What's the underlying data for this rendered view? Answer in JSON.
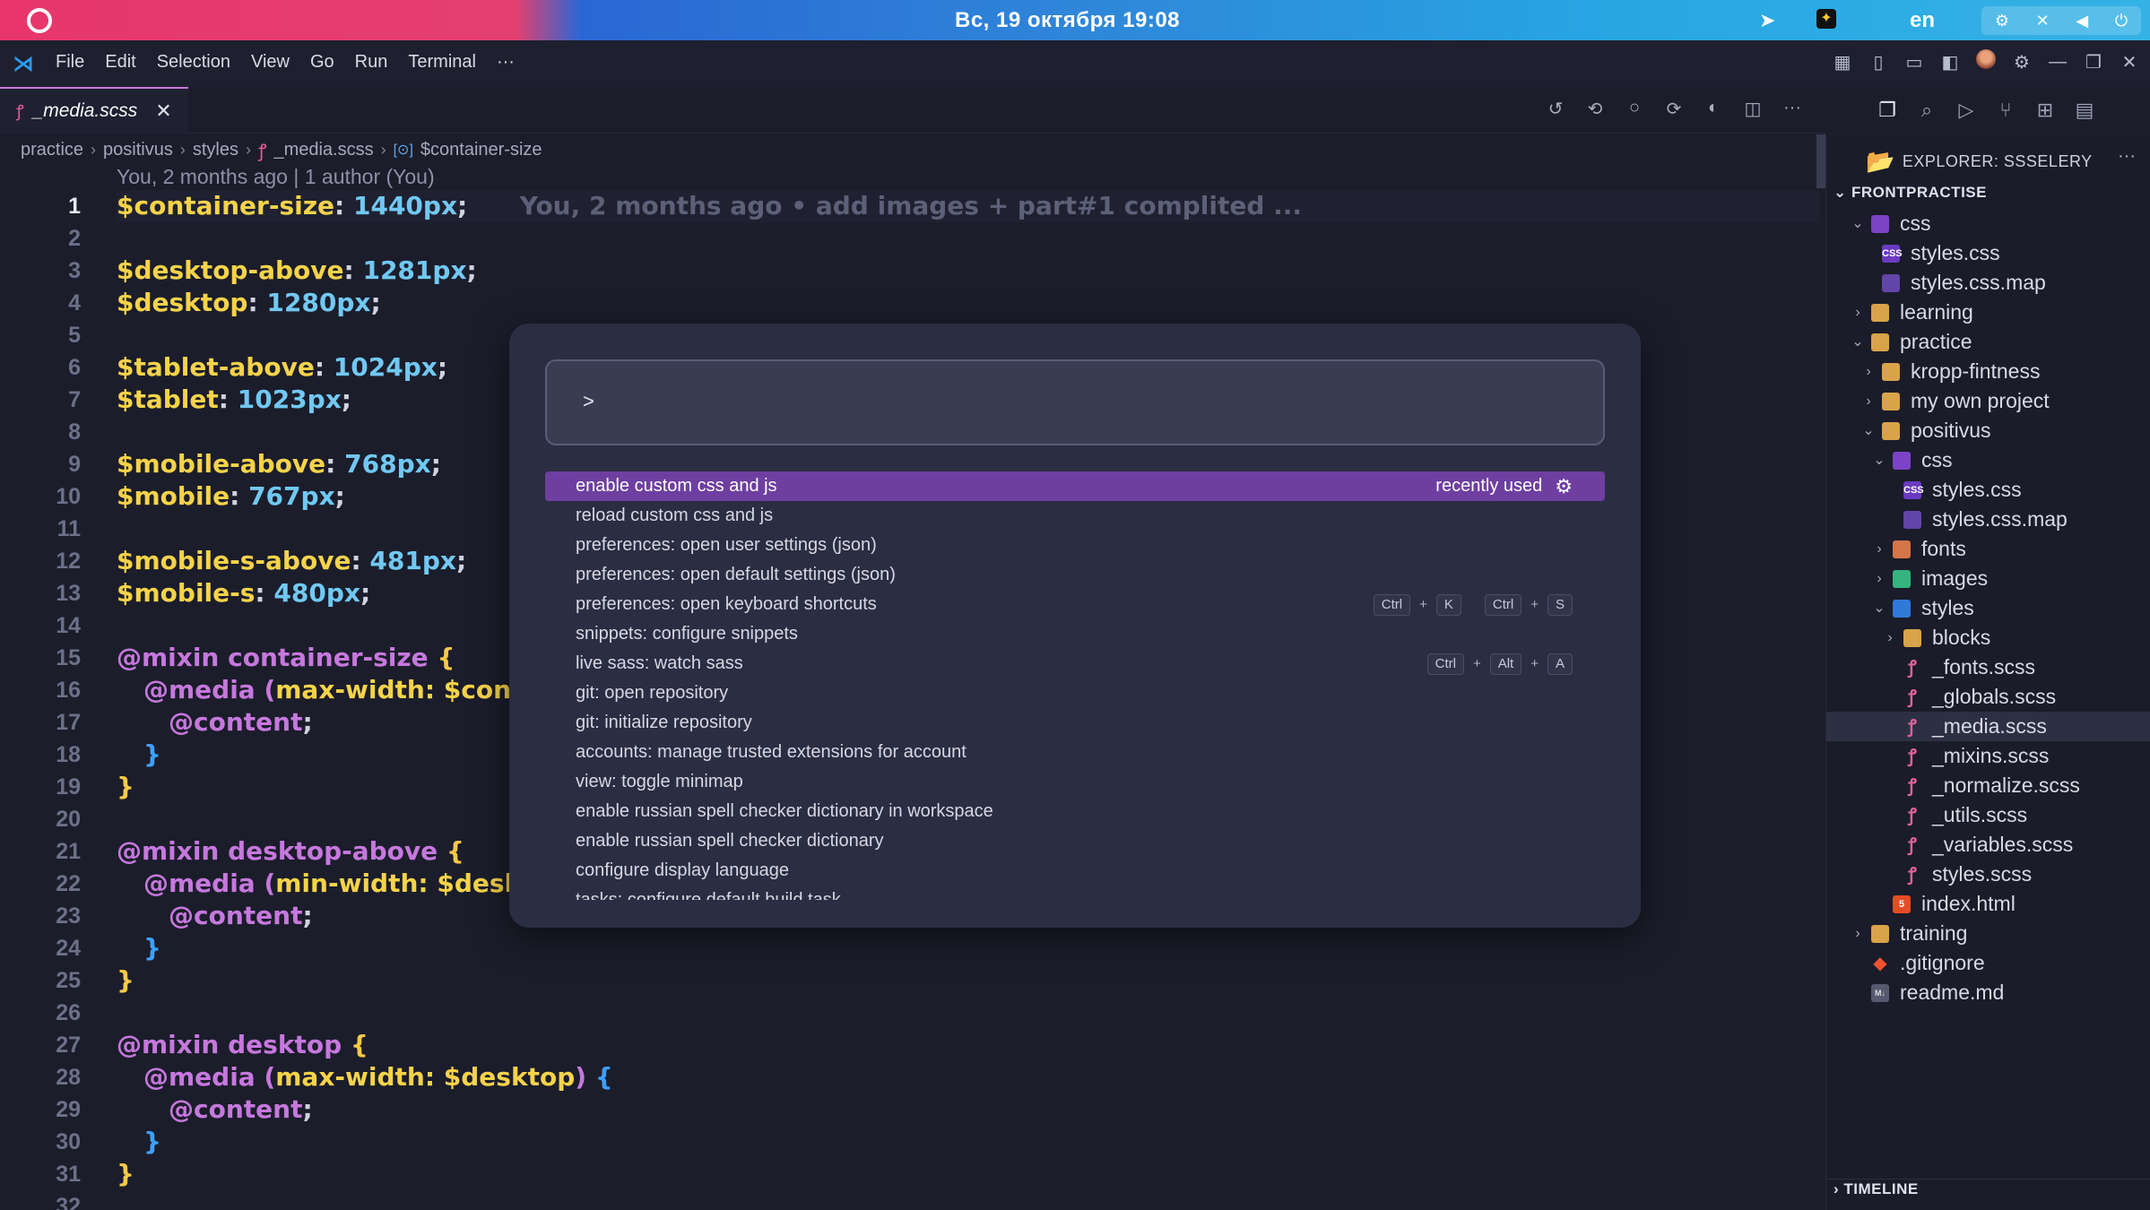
{
  "system_bar": {
    "clock": "Вс, 19 октября  19:08",
    "lang": "en"
  },
  "menubar": {
    "items": [
      "File",
      "Edit",
      "Selection",
      "View",
      "Go",
      "Run",
      "Terminal",
      "···"
    ]
  },
  "tab": {
    "name": "_media.scss",
    "close": "✕"
  },
  "breadcrumb": [
    "practice",
    "positivus",
    "styles",
    "_media.scss",
    "$container-size"
  ],
  "codelens": "You, 2 months ago | 1 author (You)",
  "blame": "You, 2 months ago • add images + part#1 complited ...",
  "line_numbers": [
    "1",
    "2",
    "3",
    "4",
    "5",
    "6",
    "7",
    "8",
    "9",
    "10",
    "11",
    "12",
    "13",
    "14",
    "15",
    "16",
    "17",
    "18",
    "19",
    "20",
    "21",
    "22",
    "23",
    "24",
    "25",
    "26",
    "27",
    "28",
    "29",
    "30",
    "31",
    "32"
  ],
  "code": {
    "l1": {
      "var": "$container-size",
      "colon": ":",
      "val": "1440px",
      "semi": ";"
    },
    "l3": {
      "var": "$desktop-above",
      "colon": ":",
      "val": "1281px",
      "semi": ";"
    },
    "l4": {
      "var": "$desktop",
      "colon": ":",
      "val": "1280px",
      "semi": ";"
    },
    "l6": {
      "var": "$tablet-above",
      "colon": ":",
      "val": "1024px",
      "semi": ";"
    },
    "l7": {
      "var": "$tablet",
      "colon": ":",
      "val": "1023px",
      "semi": ";"
    },
    "l9": {
      "var": "$mobile-above",
      "colon": ":",
      "val": "768px",
      "semi": ";"
    },
    "l10": {
      "var": "$mobile",
      "colon": ":",
      "val": "767px",
      "semi": ";"
    },
    "l12": {
      "var": "$mobile-s-above",
      "colon": ":",
      "val": "481px",
      "semi": ";"
    },
    "l13": {
      "var": "$mobile-s",
      "colon": ":",
      "val": "480px",
      "semi": ";"
    },
    "l15": {
      "kw": "@mixin",
      "name": "container-size",
      "brace": "{"
    },
    "l16": {
      "kw": "@media",
      "paren": "(",
      "rest": "max-width: $contai"
    },
    "l17": {
      "kw": "@content",
      "semi": ";"
    },
    "l18": {
      "brace": "}"
    },
    "l19": {
      "brace": "}"
    },
    "l21": {
      "kw": "@mixin",
      "name": "desktop-above",
      "brace": "{"
    },
    "l22": {
      "kw": "@media",
      "paren": "(",
      "rest": "min-width: $deskto"
    },
    "l23": {
      "kw": "@content",
      "semi": ";"
    },
    "l24": {
      "brace": "}"
    },
    "l25": {
      "brace": "}"
    },
    "l27": {
      "kw": "@mixin",
      "name": "desktop",
      "brace": "{"
    },
    "l28": {
      "kw": "@media",
      "paren": "(",
      "rest": "max-width: $desktop",
      "paren_close": ")",
      "brace": "{"
    },
    "l29": {
      "kw": "@content",
      "semi": ";"
    },
    "l30": {
      "brace": "}"
    },
    "l31": {
      "brace": "}"
    }
  },
  "palette": {
    "prompt": ">",
    "items": [
      {
        "label": "enable custom css and js",
        "note": "recently used"
      },
      {
        "label": "reload custom css and js"
      },
      {
        "label": "preferences: open user settings (json)"
      },
      {
        "label": "preferences: open default settings (json)"
      },
      {
        "label": "preferences: open keyboard shortcuts",
        "keys": [
          "Ctrl",
          "K",
          "Ctrl",
          "S"
        ]
      },
      {
        "label": "snippets: configure snippets"
      },
      {
        "label": "live sass: watch sass",
        "keys": [
          "Ctrl",
          "Alt",
          "A"
        ]
      },
      {
        "label": "git: open repository"
      },
      {
        "label": "git: initialize repository"
      },
      {
        "label": "accounts: manage trusted extensions for account"
      },
      {
        "label": "view: toggle minimap"
      },
      {
        "label": "enable russian spell checker dictionary in workspace"
      },
      {
        "label": "enable russian spell checker dictionary"
      },
      {
        "label": "configure display language"
      },
      {
        "label": "tasks: configure default build task"
      }
    ],
    "plus": "+"
  },
  "explorer": {
    "title": "EXPLORER: SSSELERY",
    "more": "···",
    "section": "FRONTPRACTISE",
    "tree": [
      {
        "label": "css",
        "depth": 1,
        "chev": "⌄",
        "icon": "cssfolder"
      },
      {
        "label": "styles.css",
        "depth": 2,
        "icon": "cssfile"
      },
      {
        "label": "styles.css.map",
        "depth": 2,
        "icon": "map"
      },
      {
        "label": "learning",
        "depth": 1,
        "chev": "›",
        "icon": "folder"
      },
      {
        "label": "practice",
        "depth": 1,
        "chev": "⌄",
        "icon": "folder"
      },
      {
        "label": "kropp-fintness",
        "depth": 2,
        "chev": "›",
        "icon": "folder"
      },
      {
        "label": "my own project",
        "depth": 2,
        "chev": "›",
        "icon": "folder"
      },
      {
        "label": "positivus",
        "depth": 2,
        "chev": "⌄",
        "icon": "folder"
      },
      {
        "label": "css",
        "depth": 3,
        "chev": "⌄",
        "icon": "cssfolder"
      },
      {
        "label": "styles.css",
        "depth": 4,
        "icon": "cssfile"
      },
      {
        "label": "styles.css.map",
        "depth": 4,
        "icon": "map"
      },
      {
        "label": "fonts",
        "depth": 3,
        "chev": "›",
        "icon": "fontfolder"
      },
      {
        "label": "images",
        "depth": 3,
        "chev": "›",
        "icon": "imgfolder"
      },
      {
        "label": "styles",
        "depth": 3,
        "chev": "⌄",
        "icon": "stylefolder"
      },
      {
        "label": "blocks",
        "depth": 4,
        "chev": "›",
        "icon": "folder"
      },
      {
        "label": "_fonts.scss",
        "depth": 4,
        "icon": "sass"
      },
      {
        "label": "_globals.scss",
        "depth": 4,
        "icon": "sass"
      },
      {
        "label": "_media.scss",
        "depth": 4,
        "icon": "sass",
        "selected": true
      },
      {
        "label": "_mixins.scss",
        "depth": 4,
        "icon": "sass"
      },
      {
        "label": "_normalize.scss",
        "depth": 4,
        "icon": "sass"
      },
      {
        "label": "_utils.scss",
        "depth": 4,
        "icon": "sass"
      },
      {
        "label": "_variables.scss",
        "depth": 4,
        "icon": "sass"
      },
      {
        "label": "styles.scss",
        "depth": 4,
        "icon": "sass"
      },
      {
        "label": "index.html",
        "depth": 3,
        "icon": "html"
      },
      {
        "label": "training",
        "depth": 1,
        "chev": "›",
        "icon": "folder"
      },
      {
        "label": ".gitignore",
        "depth": 1,
        "icon": "git"
      },
      {
        "label": "readme.md",
        "depth": 1,
        "icon": "md"
      }
    ],
    "timeline": "TIMELINE"
  },
  "icon_glyphs": {
    "css": "CSS",
    "html": "5",
    "md": "M↓",
    "sass": "ꝭ",
    "git": "◆"
  },
  "colors": {
    "accent": "#6e3fa0",
    "variable": "#f5d34a",
    "number": "#71c8f2",
    "keyword": "#c678dd"
  }
}
